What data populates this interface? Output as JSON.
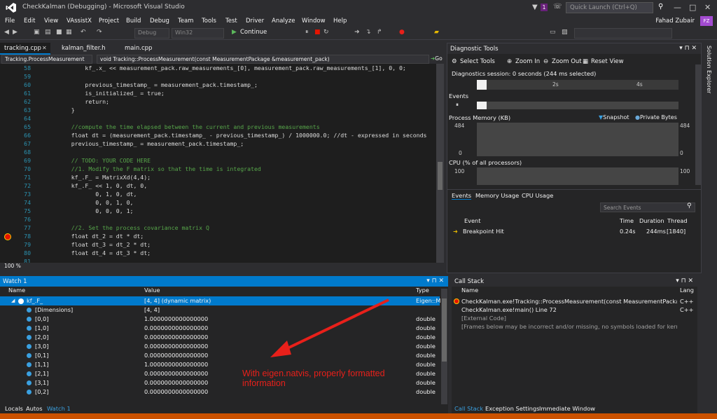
{
  "window": {
    "title": "CheckKalman (Debugging) - Microsoft Visual Studio",
    "quick_launch_placeholder": "Quick Launch (Ctrl+Q)",
    "notifications_count": "1",
    "user": "Fahad Zubair",
    "user_initials": "FZ"
  },
  "menu": [
    "File",
    "Edit",
    "View",
    "VAssistX",
    "Project",
    "Build",
    "Debug",
    "Team",
    "Tools",
    "Test",
    "Driver",
    "Analyze",
    "Window",
    "Help"
  ],
  "toolbar": {
    "config": "Debug",
    "platform": "Win32",
    "continue_label": "Continue"
  },
  "editor": {
    "tabs": [
      "tracking.cpp",
      "kalman_filter.h",
      "main.cpp"
    ],
    "scope_combo": "Tracking.ProcessMeasurement",
    "function_combo": "void Tracking::ProcessMeasurement(const MeasurementPackage &measurement_pack)",
    "go_label": "Go",
    "zoom": "100 %",
    "lines": [
      {
        "n": "58",
        "t": "        kf_.x_ << measurement_pack.raw_measurements_[0], measurement_pack.raw_measurements_[1], 0, 0;"
      },
      {
        "n": "59",
        "t": ""
      },
      {
        "n": "60",
        "t": "        previous_timestamp_ = measurement_pack.timestamp_;"
      },
      {
        "n": "61",
        "t": "        is_initialized_ = true;"
      },
      {
        "n": "62",
        "t": "        return;"
      },
      {
        "n": "63",
        "t": "    }"
      },
      {
        "n": "64",
        "t": ""
      },
      {
        "n": "65",
        "t": "    //compute the time elapsed between the current and previous measurements"
      },
      {
        "n": "66",
        "t": "    float dt = (measurement_pack.timestamp_ - previous_timestamp_) / 1000000.0; //dt - expressed in seconds"
      },
      {
        "n": "67",
        "t": "    previous_timestamp_ = measurement_pack.timestamp_;"
      },
      {
        "n": "68",
        "t": ""
      },
      {
        "n": "69",
        "t": "    // TODO: YOUR CODE HERE"
      },
      {
        "n": "70",
        "t": "    //1. Modify the F matrix so that the time is integrated"
      },
      {
        "n": "71",
        "t": "    kf_.F_ = MatrixXd(4,4);"
      },
      {
        "n": "72",
        "t": "    kf_.F_ << 1, 0, dt, 0,"
      },
      {
        "n": "73",
        "t": "           0, 1, 0, dt,"
      },
      {
        "n": "74",
        "t": "           0, 0, 1, 0,"
      },
      {
        "n": "75",
        "t": "           0, 0, 0, 1;"
      },
      {
        "n": "76",
        "t": ""
      },
      {
        "n": "77",
        "t": "    //2. Set the process covariance matrix Q"
      },
      {
        "n": "78",
        "t": "    float dt_2 = dt * dt;"
      },
      {
        "n": "79",
        "t": "    float dt_3 = dt_2 * dt;"
      },
      {
        "n": "80",
        "t": "    float dt_4 = dt_3 * dt;"
      },
      {
        "n": "81",
        "t": ""
      }
    ]
  },
  "diagnostics": {
    "title": "Diagnostic Tools",
    "select_tools": "Select Tools",
    "zoom_in": "Zoom In",
    "zoom_out": "Zoom Out",
    "reset_view": "Reset View",
    "session": "Diagnostics session: 0 seconds (244 ms selected)",
    "tick_2s": "2s",
    "tick_4s": "4s",
    "events_label": "Events",
    "memory_label": "Process Memory (KB)",
    "snapshot": "Snapshot",
    "private_bytes": "Private Bytes",
    "mem_max": "484",
    "mem_min": "0",
    "cpu_label": "CPU (% of all processors)",
    "cpu_max": "100",
    "tabs": [
      "Events",
      "Memory Usage",
      "CPU Usage"
    ],
    "search_placeholder": "Search Events",
    "columns": [
      "Event",
      "Time",
      "Duration",
      "Thread"
    ],
    "event": {
      "name": "Breakpoint Hit",
      "time": "0.24s",
      "duration": "244ms",
      "thread": "[1840]"
    }
  },
  "side_panel": "Solution Explorer",
  "watch": {
    "title": "Watch 1",
    "columns": [
      "Name",
      "Value",
      "Type"
    ],
    "root": {
      "name": "kf_.F_",
      "value": "[4, 4] (dynamic matrix)",
      "type": "Eigen::M"
    },
    "rows": [
      {
        "name": "[Dimensions]",
        "value": "[4, 4]",
        "type": ""
      },
      {
        "name": "[0,0]",
        "value": "1.0000000000000000",
        "type": "double"
      },
      {
        "name": "[1,0]",
        "value": "0.0000000000000000",
        "type": "double"
      },
      {
        "name": "[2,0]",
        "value": "0.0000000000000000",
        "type": "double"
      },
      {
        "name": "[3,0]",
        "value": "0.0000000000000000",
        "type": "double"
      },
      {
        "name": "[0,1]",
        "value": "0.0000000000000000",
        "type": "double"
      },
      {
        "name": "[1,1]",
        "value": "1.0000000000000000",
        "type": "double"
      },
      {
        "name": "[2,1]",
        "value": "0.0000000000000000",
        "type": "double"
      },
      {
        "name": "[3,1]",
        "value": "0.0000000000000000",
        "type": "double"
      },
      {
        "name": "[0,2]",
        "value": "0.0000000000000000",
        "type": "double"
      }
    ],
    "tabs": [
      "Locals",
      "Autos",
      "Watch 1"
    ]
  },
  "call_stack": {
    "title": "Call Stack",
    "columns": [
      "Name",
      "Lang"
    ],
    "rows": [
      {
        "name": "CheckKalman.exe!Tracking::ProcessMeasurement(const MeasurementPackag",
        "lang": "C++"
      },
      {
        "name": "CheckKalman.exe!main() Line 72",
        "lang": "C++"
      },
      {
        "name": "[External Code]",
        "lang": ""
      },
      {
        "name": "[Frames below may be incorrect and/or missing, no symbols loaded for kern",
        "lang": ""
      }
    ],
    "tabs": [
      "Call Stack",
      "Exception Settings",
      "Immediate Window"
    ]
  },
  "annotation": "With eigen.natvis, properly formatted information",
  "colors": {
    "accent": "#007acc",
    "annotation": "#e8201a",
    "status_bar": "#ca5100"
  }
}
